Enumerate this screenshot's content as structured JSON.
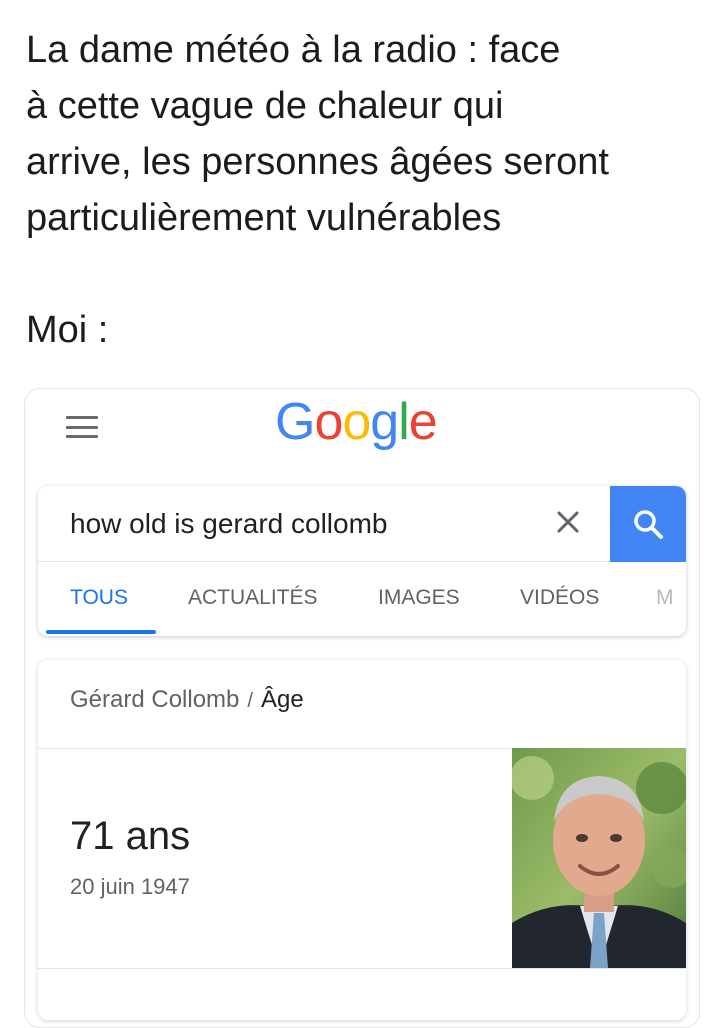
{
  "caption": {
    "lines": [
      "La dame météo à la radio : face",
      "à cette vague de chaleur qui",
      "arrive, les personnes âgées seront",
      "particulièrement vulnérables"
    ],
    "reply": "Moi :"
  },
  "google": {
    "logo_letters": [
      "G",
      "o",
      "o",
      "g",
      "l",
      "e"
    ],
    "logo_colors": [
      "#4285f4",
      "#ea4335",
      "#fbbc05",
      "#4285f4",
      "#34a853",
      "#ea4335"
    ],
    "search": {
      "query": "how old is gerard collomb",
      "accent": "#4285f4"
    },
    "tabs": [
      {
        "label": "TOUS",
        "active": true
      },
      {
        "label": "ACTUALITÉS",
        "active": false
      },
      {
        "label": "IMAGES",
        "active": false
      },
      {
        "label": "VIDÉOS",
        "active": false
      },
      {
        "label": "M",
        "active": false
      }
    ],
    "result": {
      "entity": "Gérard Collomb",
      "separator": "/",
      "attribute": "Âge",
      "age": "71 ans",
      "birth_date": "20 juin 1947",
      "photo_icon": "portrait-photo"
    }
  }
}
